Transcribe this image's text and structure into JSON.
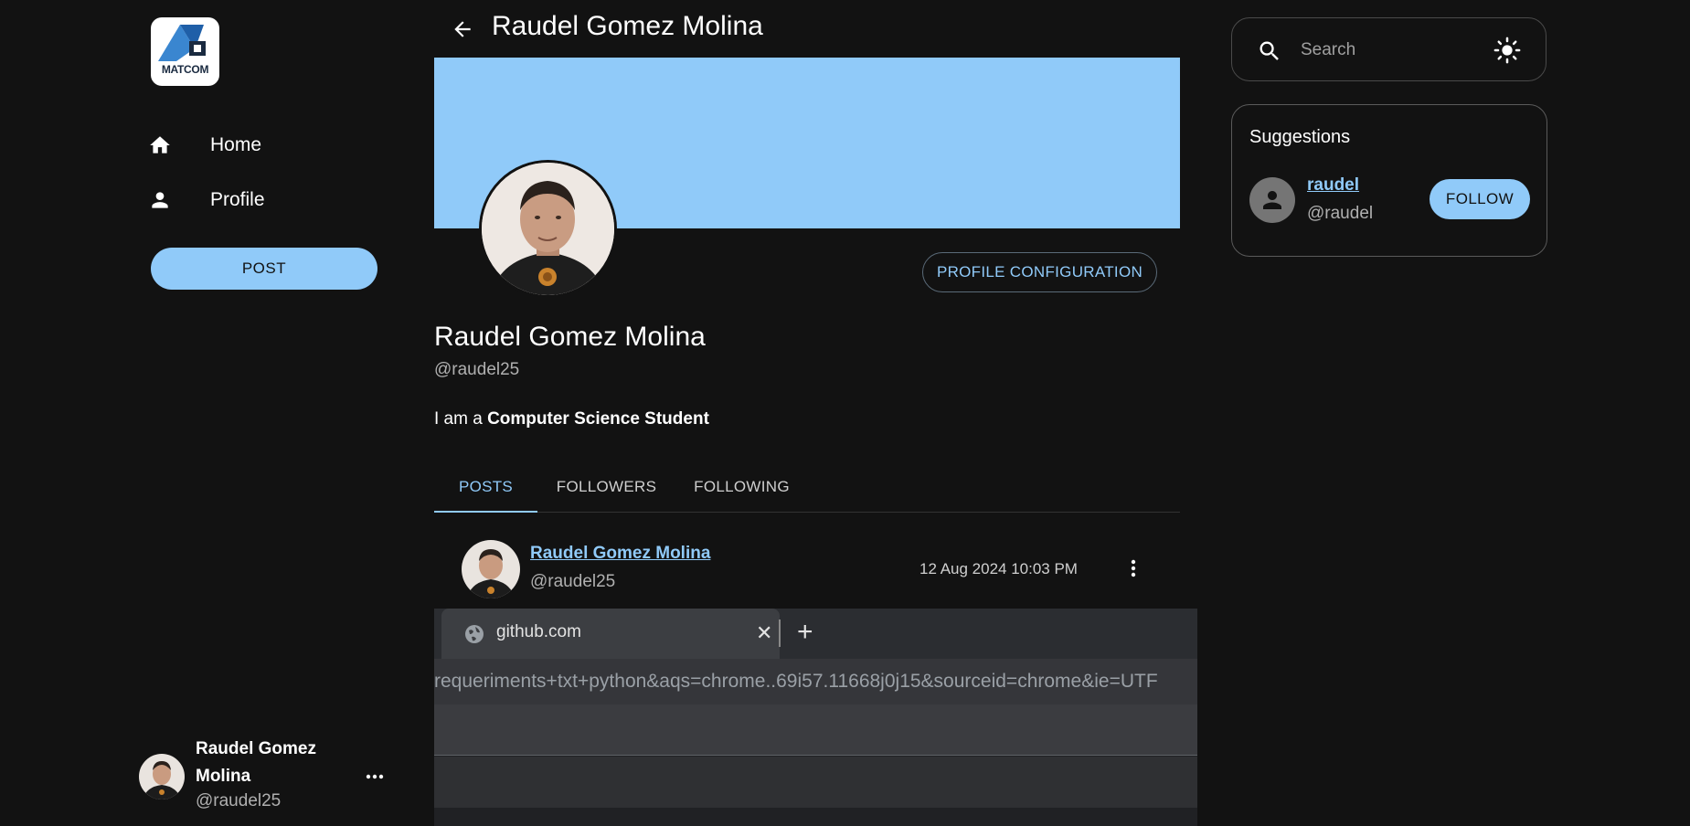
{
  "logo": {
    "text": "MATCOM"
  },
  "nav": [
    {
      "label": "Home",
      "icon": "home-icon"
    },
    {
      "label": "Profile",
      "icon": "person-icon"
    }
  ],
  "post_button": "POST",
  "current_user": {
    "name": "Raudel Gomez Molina",
    "handle": "@raudel25"
  },
  "header": {
    "title": "Raudel Gomez Molina"
  },
  "profile": {
    "name": "Raudel Gomez Molina",
    "handle": "@raudel25",
    "bio_prefix": "I am a ",
    "bio_bold": "Computer Science Student",
    "config_button": "PROFILE CONFIGURATION",
    "banner_color": "#90caf9"
  },
  "tabs": [
    {
      "label": "POSTS",
      "active": true
    },
    {
      "label": "FOLLOWERS",
      "active": false
    },
    {
      "label": "FOLLOWING",
      "active": false
    }
  ],
  "post": {
    "author": "Raudel Gomez Molina",
    "handle": "@raudel25",
    "date": "12 Aug 2024 10:03 PM",
    "image": {
      "tab_label": "github.com",
      "address_text": "requeriments+txt+python&aqs=chrome..69i57.11668j0j15&sourceid=chrome&ie=UTF"
    }
  },
  "search": {
    "placeholder": "Search"
  },
  "suggestions": {
    "title": "Suggestions",
    "items": [
      {
        "name": "raudel",
        "handle": "@raudel",
        "button": "FOLLOW"
      }
    ]
  },
  "colors": {
    "accent": "#90caf9",
    "background": "#121212"
  }
}
